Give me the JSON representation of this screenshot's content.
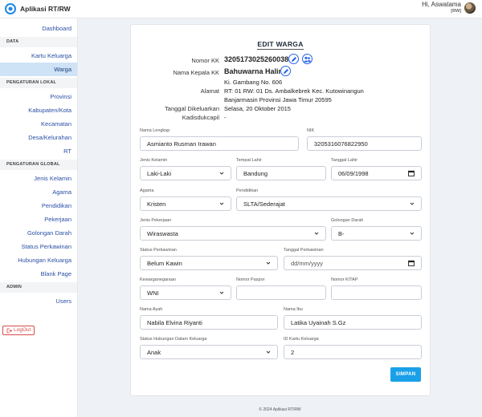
{
  "app": {
    "name": "Aplikasi RT/RW"
  },
  "user": {
    "greeting": "Hi, Aswatama",
    "role": "[RW]"
  },
  "sidebar": {
    "dashboard": "Dashboard",
    "section_data": "DATA",
    "kartu_keluarga": "Kartu Keluarga",
    "warga": "Warga",
    "section_lokal": "PENGATURAN LOKAL",
    "provinsi": "Provinsi",
    "kabupaten": "Kabupaten/Kota",
    "kecamatan": "Kecamatan",
    "desa": "Desa/Kelurahan",
    "rt": "RT",
    "section_global": "PENGATURAN GLOBAL",
    "jenis_kelamin": "Jenis Kelamin",
    "agama": "Agama",
    "pendidikan": "Pendidikan",
    "pekerjaan": "Pekerjaan",
    "golongan_darah": "Golongan Darah",
    "status_perkawinan": "Status Perkawinan",
    "hubungan_keluarga": "Hubungan Keluarga",
    "blank_page": "Blank Page",
    "section_admin": "ADMIN",
    "users": "Users",
    "logout": "LogOut"
  },
  "form": {
    "title": "EDIT WARGA",
    "info": {
      "nomor_kk_label": "Nomor KK",
      "nomor_kk": "3205173025260038",
      "kepala_label": "Nama Kepala KK",
      "kepala": "Bahuwarna Halim",
      "alamat_label": "Alamat",
      "alamat_1": "Ki. Gambang No. 606",
      "alamat_2": "RT: 01 RW: 01 Ds. Ambalkebrek Kec. Kutowinangun",
      "alamat_3": "Banjarmasin Provinsi Jawa Timur 20595",
      "tanggal_label": "Tanggal Dikeluarkan",
      "tanggal": "Selasa, 20 Oktober 2015",
      "disduk_label": "Kadisdukcapil",
      "disduk": "-"
    },
    "fields": {
      "nama_label": "Nama Lengkap",
      "nama": "Asmianto Rusman Irawan",
      "nik_label": "NIK",
      "nik": "3205316076822950",
      "jk_label": "Jenis Kelamin",
      "jk": "Laki-Laki",
      "tempat_label": "Tempat Lahir",
      "tempat": "Bandung",
      "tgl_lahir_label": "Tanggal Lahir",
      "tgl_lahir": "06/09/1998",
      "agama_label": "Agama",
      "agama": "Kristen",
      "pendidikan_label": "Pendidikan",
      "pendidikan": "SLTA/Sederajat",
      "pekerjaan_label": "Jenis Pekerjaan",
      "pekerjaan": "Wiraswasta",
      "goldar_label": "Golongan Darah",
      "goldar": "B-",
      "status_label": "Status Perkawinan",
      "status": "Belum Kawin",
      "tgl_kawin_label": "Tanggal Perkawinan",
      "tgl_kawin_placeholder": "dd/mm/yyyy",
      "kewarga_label": "Kewarganegaraan",
      "kewarga": "WNI",
      "paspor_label": "Nomor Paspor",
      "paspor": "",
      "kitap_label": "Nomor KITAP",
      "kitap": "",
      "ayah_label": "Nama Ayah",
      "ayah": "Nabila Elvina Riyanti",
      "ibu_label": "Nama Ibu",
      "ibu": "Latika Uyainah S.Gz",
      "hubungan_label": "Status Hubungan Dalam Keluarga",
      "hubungan": "Anak",
      "id_kk_label": "ID Kartu Keluarga",
      "id_kk": "2"
    },
    "save_label": "SIMPAN"
  },
  "footer": "© 2024 Aplikasi RT/RW"
}
